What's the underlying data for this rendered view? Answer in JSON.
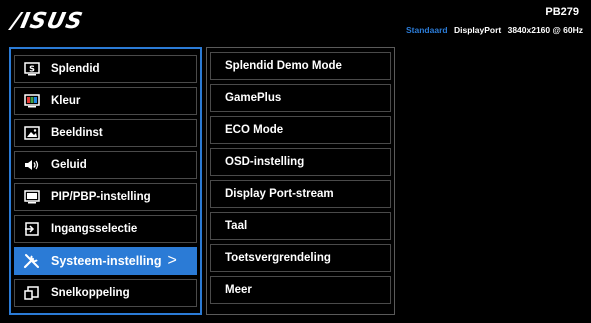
{
  "header": {
    "logo_text": "/ISUS",
    "model": "PB279",
    "status": {
      "mode": "Standaard",
      "port": "DisplayPort",
      "resolution": "3840x2160 @ 60Hz"
    }
  },
  "left_menu": {
    "items": [
      {
        "label": "Splendid",
        "icon": "splendid-icon"
      },
      {
        "label": "Kleur",
        "icon": "color-icon"
      },
      {
        "label": "Beeldinst",
        "icon": "image-icon"
      },
      {
        "label": "Geluid",
        "icon": "speaker-icon"
      },
      {
        "label": "PIP/PBP-instelling",
        "icon": "pip-icon"
      },
      {
        "label": "Ingangsselectie",
        "icon": "input-icon"
      },
      {
        "label": "Systeem-instelling",
        "icon": "tools-icon",
        "selected": true
      },
      {
        "label": "Snelkoppeling",
        "icon": "shortcut-icon"
      }
    ],
    "selected_chevron": ">"
  },
  "sub_menu": {
    "items": [
      {
        "label": "Splendid Demo Mode"
      },
      {
        "label": "GamePlus"
      },
      {
        "label": "ECO Mode"
      },
      {
        "label": "OSD-instelling"
      },
      {
        "label": "Display Port-stream"
      },
      {
        "label": "Taal"
      },
      {
        "label": "Toetsvergrendeling"
      },
      {
        "label": "Meer"
      }
    ]
  },
  "colors": {
    "accent": "#2b7bd6",
    "background": "#000000",
    "text": "#ffffff"
  }
}
